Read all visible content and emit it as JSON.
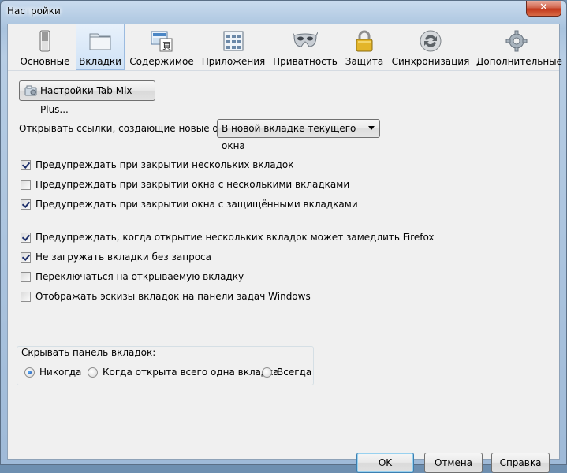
{
  "window": {
    "title": "Настройки",
    "close_label": "✕"
  },
  "panes": [
    {
      "label": "Основные",
      "icon": "general-switch-icon",
      "active": false
    },
    {
      "label": "Вкладки",
      "icon": "tabs-folder-icon",
      "active": true
    },
    {
      "label": "Содержимое",
      "icon": "content-icon",
      "active": false
    },
    {
      "label": "Приложения",
      "icon": "applications-icon",
      "active": false
    },
    {
      "label": "Приватность",
      "icon": "privacy-mask-icon",
      "active": false
    },
    {
      "label": "Защита",
      "icon": "security-lock-icon",
      "active": false
    },
    {
      "label": "Синхронизация",
      "icon": "sync-icon",
      "active": false
    },
    {
      "label": "Дополнительные",
      "icon": "advanced-gear-icon",
      "active": false
    }
  ],
  "tabs_pane": {
    "tabmix_button": "Настройки Tab Mix Plus...",
    "open_links_label": "Открывать ссылки, создающие новые окна:",
    "open_links_value": "В новой вкладке текущего окна",
    "checkboxes": [
      {
        "label": "Предупреждать при закрытии нескольких вкладок",
        "checked": true
      },
      {
        "label": "Предупреждать при закрытии окна с несколькими вкладками",
        "checked": false
      },
      {
        "label": "Предупреждать при закрытии окна с защищёнными вкладками",
        "checked": true
      },
      {
        "label": "Предупреждать, когда открытие нескольких вкладок может замедлить Firefox",
        "checked": true
      },
      {
        "label": "Не загружать вкладки без запроса",
        "checked": true
      },
      {
        "label": "Переключаться на открываемую вкладку",
        "checked": false
      },
      {
        "label": "Отображать эскизы вкладок на панели задач Windows",
        "checked": false
      }
    ],
    "hide_tabbar": {
      "caption": "Скрывать панель вкладок:",
      "options": [
        {
          "label": "Никогда",
          "selected": true
        },
        {
          "label": "Когда открыта всего одна вкладка",
          "selected": false
        },
        {
          "label": "Всегда",
          "selected": false
        }
      ]
    }
  },
  "dialog_buttons": {
    "ok": "OK",
    "cancel": "Отмена",
    "help": "Справка"
  },
  "colors": {
    "active_pane": "#cfe2f6",
    "client_bg": "#f0f0f0",
    "close_button": "#c2381c"
  }
}
